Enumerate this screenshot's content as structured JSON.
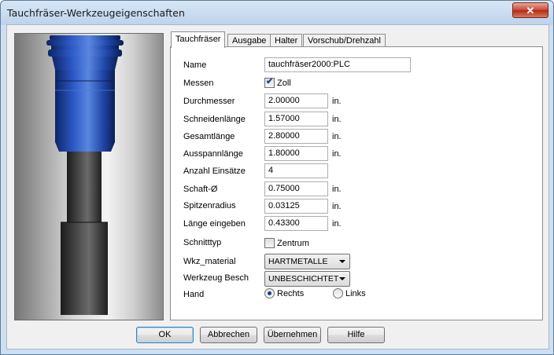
{
  "window": {
    "title": "Tauchfräser-Werkzeugeigenschaften",
    "close_glyph": "✕"
  },
  "tabs": [
    {
      "label": "Tauchfräser",
      "active": true
    },
    {
      "label": "Ausgabe",
      "active": false
    },
    {
      "label": "Halter",
      "active": false
    },
    {
      "label": "Vorschub/Drehzahl",
      "active": false
    }
  ],
  "form": {
    "name": {
      "label": "Name",
      "value": "tauchfräser2000:PLC"
    },
    "messen": {
      "label": "Messen",
      "checkbox_label": "Zoll",
      "checked": true
    },
    "fields": [
      {
        "label": "Durchmesser",
        "value": "2.00000",
        "unit": "in."
      },
      {
        "label": "Schneidenlänge",
        "value": "1.57000",
        "unit": "in."
      },
      {
        "label": "Gesamtlänge",
        "value": "2.80000",
        "unit": "in."
      },
      {
        "label": "Ausspannlänge",
        "value": "1.80000",
        "unit": "in."
      },
      {
        "label": "Anzahl Einsätze",
        "value": "4",
        "unit": ""
      },
      {
        "label": "Schaft-Ø",
        "value": "0.75000",
        "unit": "in."
      },
      {
        "label": "Spitzenradius",
        "value": "0.03125",
        "unit": "in."
      },
      {
        "label": "Länge eingeben",
        "value": "0.43300",
        "unit": "in."
      }
    ],
    "schnitttyp": {
      "label": "Schnitttyp",
      "checkbox_label": "Zentrum",
      "checked": false
    },
    "wkz_material": {
      "label": "Wkz_material",
      "value": "HARTMETALLE"
    },
    "werkzeug_besch": {
      "label": "Werkzeug Besch",
      "value": "UNBESCHICHTET"
    },
    "hand": {
      "label": "Hand",
      "option_right": "Rechts",
      "option_left": "Links",
      "selected": "Rechts"
    }
  },
  "buttons": {
    "ok": "OK",
    "cancel": "Abbrechen",
    "apply": "Übernehmen",
    "help": "Hilfe"
  },
  "colors": {
    "tool_body": "#1f4aa6",
    "shank": "#3a3a3a"
  },
  "icons": {
    "close": "close-icon",
    "checkbox_check": "checkmark-icon",
    "dropdown": "chevron-down-icon"
  }
}
